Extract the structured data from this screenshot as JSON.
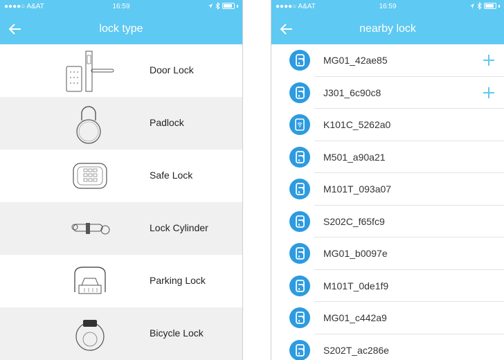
{
  "left": {
    "status": {
      "carrier": "●●●●○ A&AT",
      "time": "16:59"
    },
    "title": "lock type",
    "types": [
      {
        "label": "Door Lock",
        "icon": "door-lock-icon"
      },
      {
        "label": "Padlock",
        "icon": "padlock-icon"
      },
      {
        "label": "Safe Lock",
        "icon": "safe-lock-icon"
      },
      {
        "label": "Lock Cylinder",
        "icon": "lock-cylinder-icon"
      },
      {
        "label": "Parking Lock",
        "icon": "parking-lock-icon"
      },
      {
        "label": "Bicycle Lock",
        "icon": "bicycle-lock-icon"
      }
    ]
  },
  "right": {
    "status": {
      "carrier": "●●●●○ A&AT",
      "time": "16:59"
    },
    "title": "nearby lock",
    "locks": [
      {
        "name": "MG01_42ae85",
        "type": "door",
        "add": true
      },
      {
        "name": "J301_6c90c8",
        "type": "door",
        "add": true
      },
      {
        "name": "K101C_5262a0",
        "type": "keypad",
        "add": false
      },
      {
        "name": "M501_a90a21",
        "type": "door",
        "add": false
      },
      {
        "name": "M101T_093a07",
        "type": "door",
        "add": false
      },
      {
        "name": "S202C_f65fc9",
        "type": "door",
        "add": false
      },
      {
        "name": "MG01_b0097e",
        "type": "door",
        "add": false
      },
      {
        "name": "M101T_0de1f9",
        "type": "door",
        "add": false
      },
      {
        "name": "MG01_c442a9",
        "type": "door",
        "add": false
      },
      {
        "name": "S202T_ac286e",
        "type": "door",
        "add": false
      }
    ]
  },
  "colors": {
    "accent": "#5ec9f2",
    "lock_icon": "#2d9be0",
    "row_alt": "#f0f0f0"
  }
}
